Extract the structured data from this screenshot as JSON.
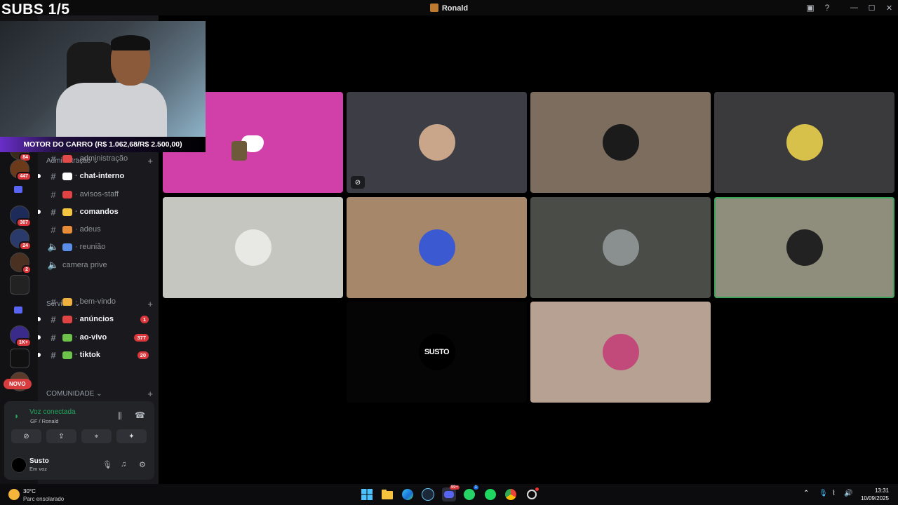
{
  "overlay": {
    "subs_label": "SUBS 1/5",
    "motor_banner": "MOTOR DO CARRO (R$ 1.062,68/R$ 2.500,00)"
  },
  "window": {
    "title": "Ronald",
    "min": "—",
    "max": "☐",
    "close": "✕"
  },
  "guilds": [
    {
      "badge": "84"
    },
    {
      "badge": "447"
    },
    {
      "badge": ""
    },
    {
      "badge": "307"
    },
    {
      "badge": "24"
    },
    {
      "badge": "2"
    },
    {
      "badge": ""
    },
    {
      "badge": ""
    },
    {
      "badge": "1K+"
    },
    {
      "badge": ""
    },
    {
      "badge": ""
    }
  ],
  "novo_label": "NOVO",
  "sidebar": {
    "cat_admin": "Administração",
    "cat_servidor": "Servidor",
    "cat_comunidade": "COMUNIDADE",
    "channels": [
      {
        "name": "administração",
        "type": "text",
        "unread": false,
        "badge": "",
        "emoji_color": "#e34b4b"
      },
      {
        "name": "chat-interno",
        "type": "text",
        "unread": true,
        "badge": "",
        "emoji_color": "#ffffff"
      },
      {
        "name": "avisos-staff",
        "type": "text",
        "unread": false,
        "badge": "",
        "emoji_color": "#e04343"
      },
      {
        "name": "comandos",
        "type": "text",
        "unread": true,
        "badge": "",
        "emoji_color": "#f5c542"
      },
      {
        "name": "adeus",
        "type": "text",
        "unread": false,
        "badge": "",
        "emoji_color": "#e58b3a"
      },
      {
        "name": "reunião",
        "type": "voice",
        "unread": false,
        "badge": "",
        "emoji_color": "#5b8ee6"
      },
      {
        "name": "camera prive",
        "type": "voice",
        "unread": false,
        "badge": "",
        "emoji_color": ""
      },
      {
        "name": "bem-vindo",
        "type": "text",
        "unread": false,
        "badge": "",
        "emoji_color": "#f0b040"
      },
      {
        "name": "anúncios",
        "type": "text",
        "unread": true,
        "badge": "1",
        "emoji_color": "#e04343"
      },
      {
        "name": "ao-vivo",
        "type": "text",
        "unread": true,
        "badge": "377",
        "emoji_color": "#6cc24a"
      },
      {
        "name": "tiktok",
        "type": "text",
        "unread": true,
        "badge": "20",
        "emoji_color": "#6cc24a"
      }
    ]
  },
  "voice_panel": {
    "status": "Voz conectada",
    "location": "GF / Ronald",
    "user_name": "Susto",
    "user_status": "Em voz"
  },
  "stage": {
    "tiles": [
      {
        "bg": "#d13fa8",
        "kind": "discord",
        "muted": false,
        "speaking": false
      },
      {
        "bg": "#3d3e45",
        "kind": "avatar",
        "muted": true,
        "speaking": false,
        "av": "#c9a58a"
      },
      {
        "bg": "#7d6d5e",
        "kind": "avatar",
        "muted": false,
        "speaking": false,
        "av": "#1b1b1b"
      },
      {
        "bg": "#3a3a3d",
        "kind": "avatar",
        "muted": false,
        "speaking": false,
        "av": "#d8c14a"
      },
      {
        "bg": "#c6c6c0",
        "kind": "avatar",
        "muted": false,
        "speaking": false,
        "av": "#e8e8e4"
      },
      {
        "bg": "#a7876a",
        "kind": "avatar",
        "muted": false,
        "speaking": false,
        "av": "#3b5ad1"
      },
      {
        "bg": "#4a4d47",
        "kind": "avatar",
        "muted": false,
        "speaking": false,
        "av": "#8a9090"
      },
      {
        "bg": "#8f8e7c",
        "kind": "avatar",
        "muted": false,
        "speaking": true,
        "av": "#222"
      },
      {
        "bg": "#050505",
        "kind": "susto",
        "muted": false,
        "speaking": false,
        "logo": "SUSTO"
      },
      {
        "bg": "#b7a193",
        "kind": "avatar",
        "muted": false,
        "speaking": false,
        "av": "#c24a7a"
      }
    ]
  },
  "taskbar": {
    "temp": "30°C",
    "weather": "Parc ensolarado",
    "time": "13:31",
    "date": "10/09/2025",
    "discord_badge": "99+",
    "whatsapp_badge": "1"
  },
  "colors": {
    "voice_green": "#23a55a",
    "badge_red": "#da373c",
    "accent": "#5865f2"
  }
}
